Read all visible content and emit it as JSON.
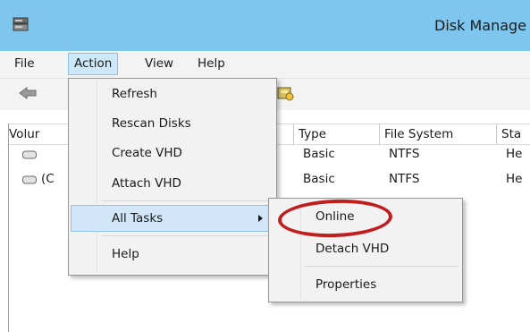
{
  "window": {
    "title": "Disk Manage"
  },
  "menubar": {
    "items": [
      "File",
      "Action",
      "View",
      "Help"
    ]
  },
  "columns": [
    "Volur",
    "Type",
    "File System",
    "Sta"
  ],
  "rows": [
    {
      "volume": "",
      "type": "Basic",
      "fs": "NTFS",
      "status": "He"
    },
    {
      "volume": "(C",
      "type": "Basic",
      "fs": "NTFS",
      "status": "He"
    }
  ],
  "action_menu": {
    "items": [
      "Refresh",
      "Rescan Disks",
      "Create VHD",
      "Attach VHD",
      "All Tasks",
      "Help"
    ]
  },
  "all_tasks_submenu": {
    "items": [
      "Online",
      "Detach VHD",
      "Properties"
    ]
  },
  "colors": {
    "titlebar": "#7ec6ee",
    "highlight": "#d1e7f9",
    "annotation": "#c21d1d"
  }
}
